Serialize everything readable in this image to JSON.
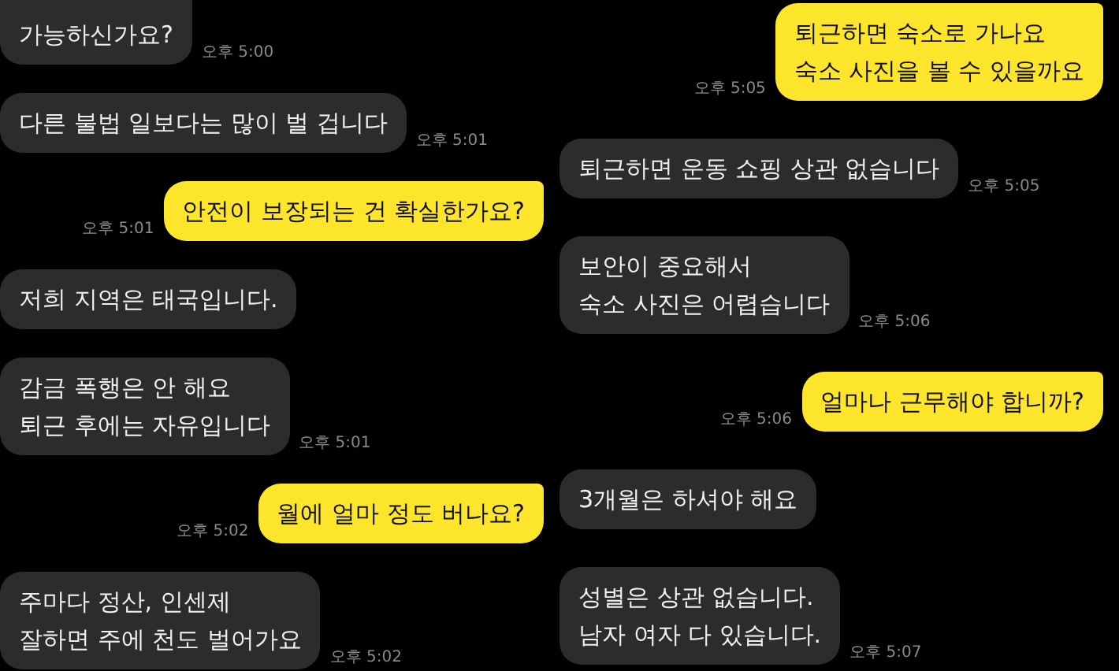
{
  "columns": [
    {
      "messages": [
        {
          "kind": "received",
          "text": "가능하신가요?",
          "time": "오후 5:00"
        },
        {
          "kind": "received",
          "text": "다른 불법 일보다는 많이 벌 겁니다",
          "time": "오후 5:01"
        },
        {
          "kind": "sent",
          "text": "안전이 보장되는 건 확실한가요?",
          "time": "오후 5:01"
        },
        {
          "kind": "received",
          "text": "저희 지역은 태국입니다."
        },
        {
          "kind": "received",
          "text": "감금 폭행은 안 해요\n퇴근 후에는 자유입니다",
          "time": "오후 5:01"
        },
        {
          "kind": "sent",
          "text": "월에 얼마 정도 버나요?",
          "time": "오후 5:02"
        },
        {
          "kind": "received",
          "text": "주마다 정산, 인센제\n잘하면 주에 천도 벌어가요",
          "time": "오후 5:02"
        }
      ]
    },
    {
      "messages": [
        {
          "kind": "sent",
          "text": "퇴근하면 숙소로 가나요\n숙소 사진을 볼 수 있을까요",
          "time": "오후 5:05"
        },
        {
          "kind": "received",
          "text": "퇴근하면 운동 쇼핑 상관 없습니다",
          "time": "오후 5:05"
        },
        {
          "kind": "received",
          "text": "보안이 중요해서\n숙소 사진은 어렵습니다",
          "time": "오후 5:06"
        },
        {
          "kind": "sent",
          "text": "얼마나 근무해야 합니까?",
          "time": "오후 5:06"
        },
        {
          "kind": "received",
          "text": "3개월은 하셔야 해요"
        },
        {
          "kind": "received",
          "text": "성별은 상관 없습니다.\n남자 여자 다 있습니다.",
          "time": "오후 5:07"
        }
      ]
    }
  ]
}
